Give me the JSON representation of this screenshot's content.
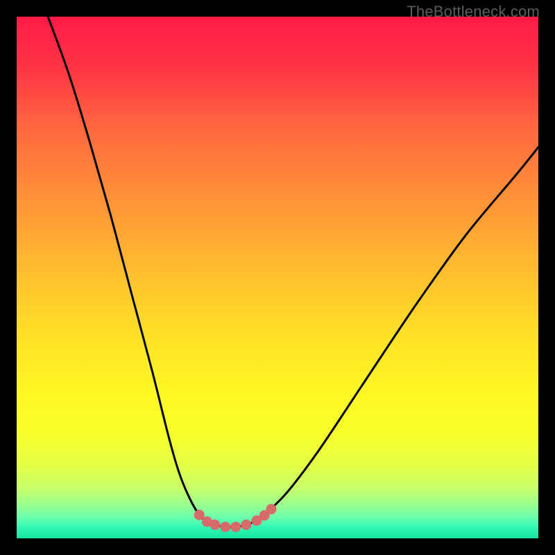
{
  "watermark": {
    "text": "TheBottleneck.com"
  },
  "gradient": {
    "stops": [
      {
        "offset": 0.0,
        "color": "#ff1a46"
      },
      {
        "offset": 0.1,
        "color": "#ff3545"
      },
      {
        "offset": 0.22,
        "color": "#ff6a3f"
      },
      {
        "offset": 0.35,
        "color": "#ff9238"
      },
      {
        "offset": 0.5,
        "color": "#ffc22e"
      },
      {
        "offset": 0.62,
        "color": "#ffe326"
      },
      {
        "offset": 0.72,
        "color": "#fff724"
      },
      {
        "offset": 0.8,
        "color": "#f8ff2a"
      },
      {
        "offset": 0.86,
        "color": "#e4ff46"
      },
      {
        "offset": 0.905,
        "color": "#c5ff6a"
      },
      {
        "offset": 0.935,
        "color": "#9cff8e"
      },
      {
        "offset": 0.96,
        "color": "#6affae"
      },
      {
        "offset": 0.98,
        "color": "#30f7b4"
      },
      {
        "offset": 1.0,
        "color": "#18e59f"
      }
    ]
  },
  "chart_data": {
    "type": "line",
    "title": "",
    "xlabel": "",
    "ylabel": "",
    "xlim": [
      0,
      100
    ],
    "ylim": [
      0,
      100
    ],
    "note": "Axes are unlabeled; x/y are normalized 0–100 left→right / bottom→top. Curve read from pixels.",
    "series": [
      {
        "name": "bottleneck-curve",
        "x": [
          6,
          10,
          14,
          18,
          22,
          26,
          29,
          31,
          33,
          35,
          36.5,
          38,
          40,
          42,
          44,
          46,
          48,
          52,
          58,
          66,
          76,
          86,
          96,
          100
        ],
        "y": [
          100,
          89,
          76,
          62,
          47,
          32,
          20,
          13,
          8,
          4.5,
          3.2,
          2.6,
          2.2,
          2.2,
          2.6,
          3.4,
          5,
          9,
          17,
          29,
          44,
          58,
          70,
          75
        ]
      },
      {
        "name": "highlight-dots",
        "x": [
          35,
          36.5,
          38,
          40,
          42,
          44,
          46,
          47.5,
          48.8
        ],
        "y": [
          4.5,
          3.2,
          2.6,
          2.2,
          2.2,
          2.6,
          3.4,
          4.4,
          5.6
        ]
      }
    ],
    "highlight_color": "#d96a6a",
    "curve_color": "#000000"
  }
}
